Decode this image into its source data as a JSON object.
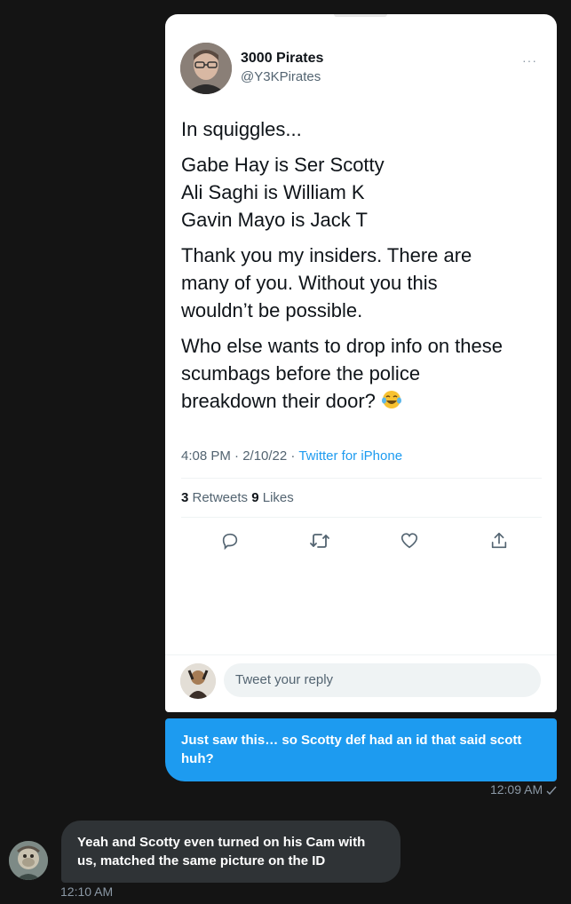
{
  "tweet": {
    "author_name": "3000 Pirates",
    "author_handle": "@Y3KPirates",
    "more_label": "···",
    "paragraphs": {
      "p1": "In squiggles...",
      "p2": [
        "Gabe Hay is Ser Scotty",
        "Ali Saghi is William K",
        "Gavin Mayo is Jack T"
      ],
      "p3": [
        "Thank you my insiders. There are",
        "many of you. Without you this",
        "wouldn’t be possible."
      ],
      "p4": [
        "Who else wants to drop info on these",
        "scumbags before the police",
        "breakdown their door?"
      ]
    },
    "emoji": "laughing-tears-emoji",
    "timestamp": "4:08 PM · 2/10/22 · ",
    "source": "Twitter for iPhone",
    "retweets_count": "3",
    "retweets_label": " Retweets  ",
    "likes_count": "9",
    "likes_label": " Likes",
    "actions": [
      "reply-icon",
      "retweet-icon",
      "like-icon",
      "share-icon"
    ],
    "reply_placeholder": "Tweet your reply"
  },
  "messages": {
    "outgoing": {
      "text": "Just saw this… so Scotty def had an id that said scott huh?",
      "time": "12:09 AM",
      "status_icon": "sent-check-icon"
    },
    "incoming": {
      "text": "Yeah and Scotty even turned on his Cam with us, matched the same picture on the ID",
      "time": "12:10 AM"
    }
  },
  "colors": {
    "background": "#141414",
    "accent": "#1d9bf0",
    "incoming_bubble": "#2f3336",
    "muted_text": "#8b98a5"
  }
}
